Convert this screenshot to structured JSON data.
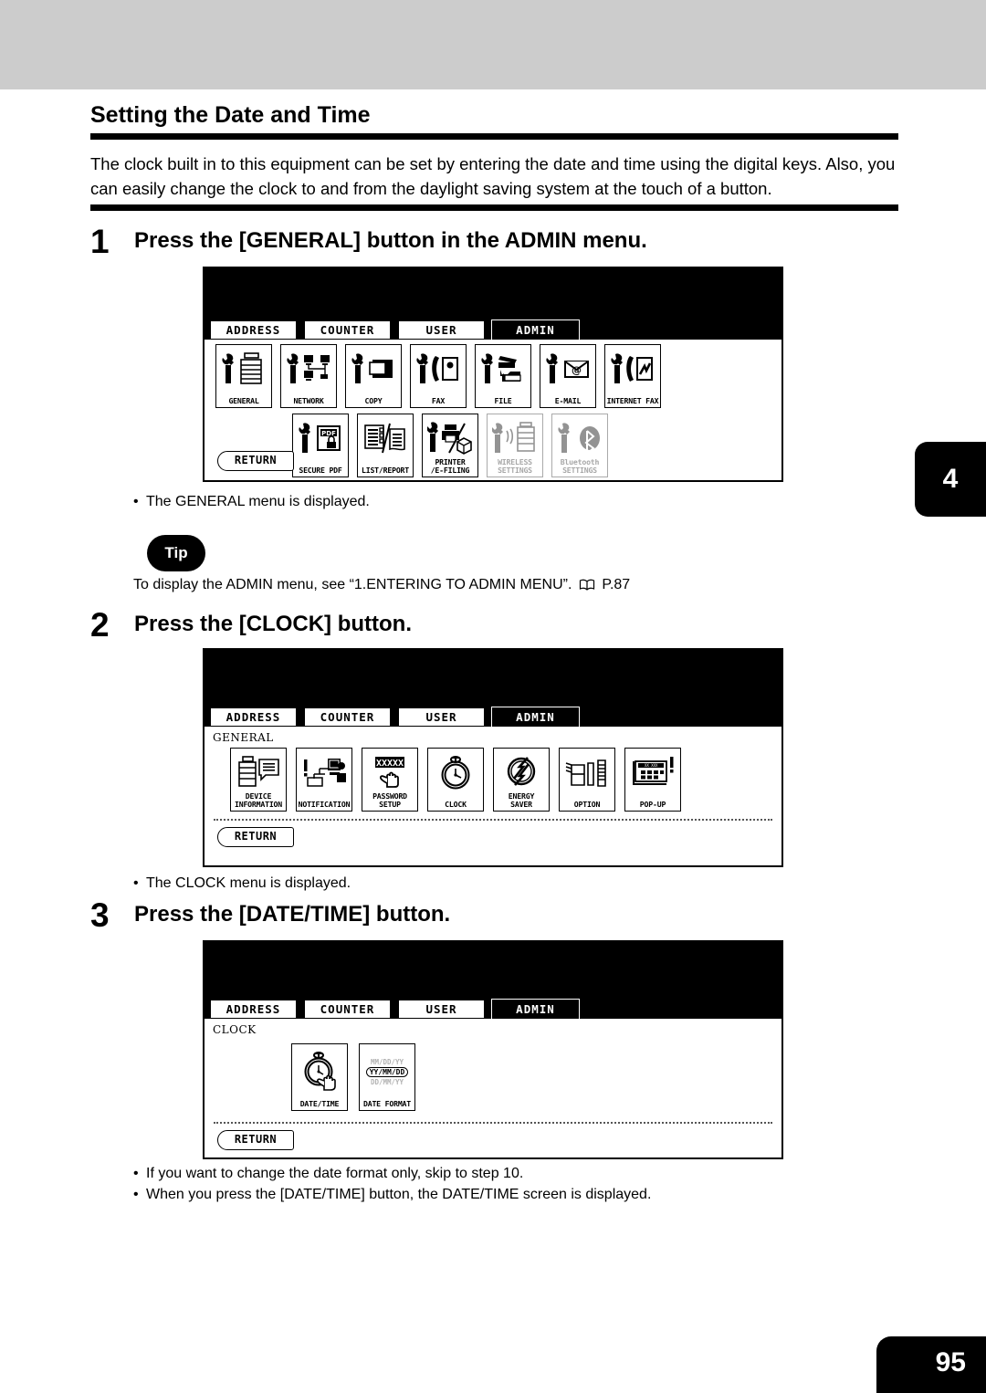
{
  "document": {
    "section_title": "Setting the Date and Time",
    "intro": "The clock built in to this equipment can be set by entering the date and time using the digital keys.  Also, you can easily change the clock to and from the daylight saving system at the touch of a button.",
    "chapter_tab": "4",
    "page_number": "95"
  },
  "steps": [
    {
      "number": "1",
      "title": "Press the [GENERAL] button in the ADMIN menu.",
      "notes": [
        "The GENERAL menu is displayed."
      ]
    },
    {
      "number": "2",
      "title": "Press the [CLOCK] button.",
      "notes": [
        "The CLOCK menu is displayed."
      ]
    },
    {
      "number": "3",
      "title": "Press the [DATE/TIME] button.",
      "notes": [
        "If you want to change the date format only, skip to step 10.",
        "When you press the [DATE/TIME] button, the DATE/TIME screen is displayed."
      ]
    }
  ],
  "tip": {
    "label": "Tip",
    "text_before": "To display the ADMIN menu, see ",
    "reference": "“1.ENTERING TO ADMIN MENU”.",
    "page_ref": "P.87"
  },
  "screens": [
    {
      "name": "admin-menu",
      "tabs": [
        {
          "label": "ADDRESS",
          "selected": false
        },
        {
          "label": "COUNTER",
          "selected": false
        },
        {
          "label": "USER",
          "selected": false
        },
        {
          "label": "ADMIN",
          "selected": true
        }
      ],
      "breadcrumb": "",
      "return_label": "RETURN",
      "row1": [
        {
          "label": "GENERAL",
          "icon": "wrench-copier-icon",
          "disabled": false
        },
        {
          "label": "NETWORK",
          "icon": "wrench-network-icon",
          "disabled": false
        },
        {
          "label": "COPY",
          "icon": "wrench-copy-icon",
          "disabled": false
        },
        {
          "label": "FAX",
          "icon": "wrench-fax-icon",
          "disabled": false
        },
        {
          "label": "FILE",
          "icon": "wrench-file-icon",
          "disabled": false
        },
        {
          "label": "E-MAIL",
          "icon": "wrench-email-icon",
          "disabled": false
        },
        {
          "label": "INTERNET FAX",
          "icon": "wrench-ifax-icon",
          "disabled": false
        }
      ],
      "row2": [
        {
          "label": "SECURE PDF",
          "icon": "wrench-pdf-lock-icon",
          "disabled": false
        },
        {
          "label": "LIST/REPORT",
          "icon": "list-report-icon",
          "disabled": false
        },
        {
          "label": "PRINTER\n/E-FILING",
          "icon": "wrench-printer-icon",
          "disabled": false
        },
        {
          "label": "WIRELESS\nSETTINGS",
          "icon": "wrench-wireless-icon",
          "disabled": true
        },
        {
          "label": "Bluetooth\nSETTINGS",
          "icon": "wrench-bluetooth-icon",
          "disabled": true
        }
      ]
    },
    {
      "name": "general-menu",
      "tabs": [
        {
          "label": "ADDRESS",
          "selected": false
        },
        {
          "label": "COUNTER",
          "selected": false
        },
        {
          "label": "USER",
          "selected": false
        },
        {
          "label": "ADMIN",
          "selected": true
        }
      ],
      "breadcrumb": "GENERAL",
      "return_label": "RETURN",
      "row1": [
        {
          "label": "DEVICE\nINFORMATION",
          "icon": "device-information-icon",
          "disabled": false
        },
        {
          "label": "NOTIFICATION",
          "icon": "notification-icon",
          "disabled": false
        },
        {
          "label": "PASSWORD SETUP",
          "icon": "password-setup-icon",
          "disabled": false
        },
        {
          "label": "CLOCK",
          "icon": "stopwatch-icon",
          "disabled": false
        },
        {
          "label": "ENERGY\nSAVER",
          "icon": "energy-saver-icon",
          "disabled": false
        },
        {
          "label": "OPTION",
          "icon": "option-icon",
          "disabled": false
        },
        {
          "label": "POP-UP",
          "icon": "pop-up-icon",
          "disabled": false
        }
      ],
      "row2": []
    },
    {
      "name": "clock-menu",
      "tabs": [
        {
          "label": "ADDRESS",
          "selected": false
        },
        {
          "label": "COUNTER",
          "selected": false
        },
        {
          "label": "USER",
          "selected": false
        },
        {
          "label": "ADMIN",
          "selected": true
        }
      ],
      "breadcrumb": "CLOCK",
      "return_label": "RETURN",
      "row1": [
        {
          "label": "DATE/TIME",
          "icon": "stopwatch-hand-icon",
          "disabled": false
        },
        {
          "label": "DATE FORMAT",
          "icon": "date-format-icon",
          "disabled": false,
          "formats": [
            "MM/DD/YY",
            "YY/MM/DD",
            "DD/MM/YY"
          ],
          "selected_format": "YY/MM/DD"
        }
      ],
      "row2": []
    }
  ]
}
